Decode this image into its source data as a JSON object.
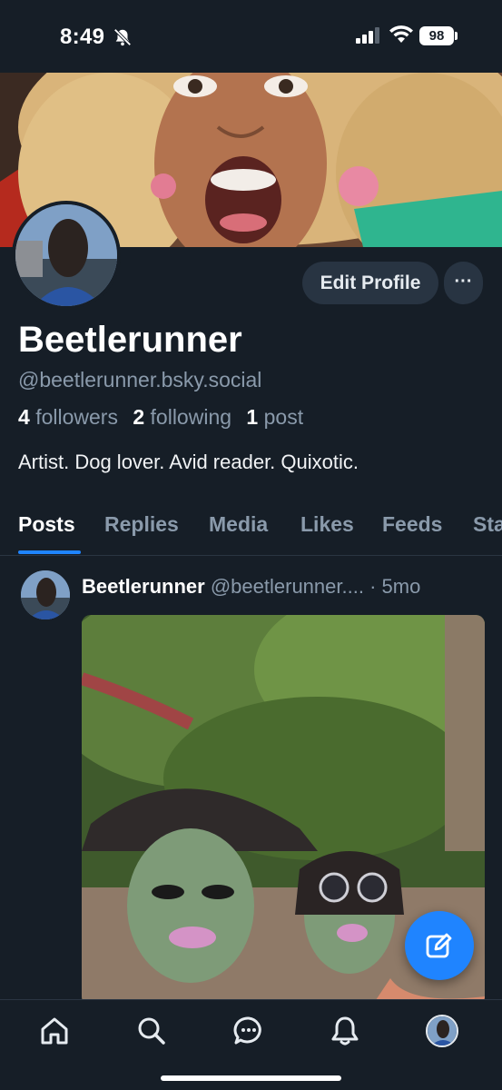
{
  "status_bar": {
    "time": "8:49",
    "battery": "98",
    "icons": [
      "bell-off-icon",
      "signal-icon",
      "wifi-icon",
      "battery-icon"
    ]
  },
  "profile": {
    "display_name": "Beetlerunner",
    "handle": "@beetlerunner.bsky.social",
    "followers_count": "4",
    "followers_label": "followers",
    "following_count": "2",
    "following_label": "following",
    "posts_count": "1",
    "posts_label": "post",
    "bio": "Artist. Dog lover. Avid reader. Quixotic.",
    "edit_profile_label": "Edit Profile",
    "more_label": "···"
  },
  "tabs": [
    {
      "label": "Posts",
      "active": true
    },
    {
      "label": "Replies",
      "active": false
    },
    {
      "label": "Media",
      "active": false
    },
    {
      "label": "Likes",
      "active": false
    },
    {
      "label": "Feeds",
      "active": false
    },
    {
      "label": "Sta",
      "active": false
    }
  ],
  "post": {
    "author": "Beetlerunner",
    "handle": "@beetlerunner....",
    "time": "· 5mo"
  },
  "bottom_nav": [
    "home-icon",
    "search-icon",
    "chat-icon",
    "bell-icon",
    "profile-avatar"
  ],
  "colors": {
    "background": "#161e27",
    "accent": "#1f84ff",
    "muted_text": "#8a9aab",
    "button_bg": "#283442"
  }
}
